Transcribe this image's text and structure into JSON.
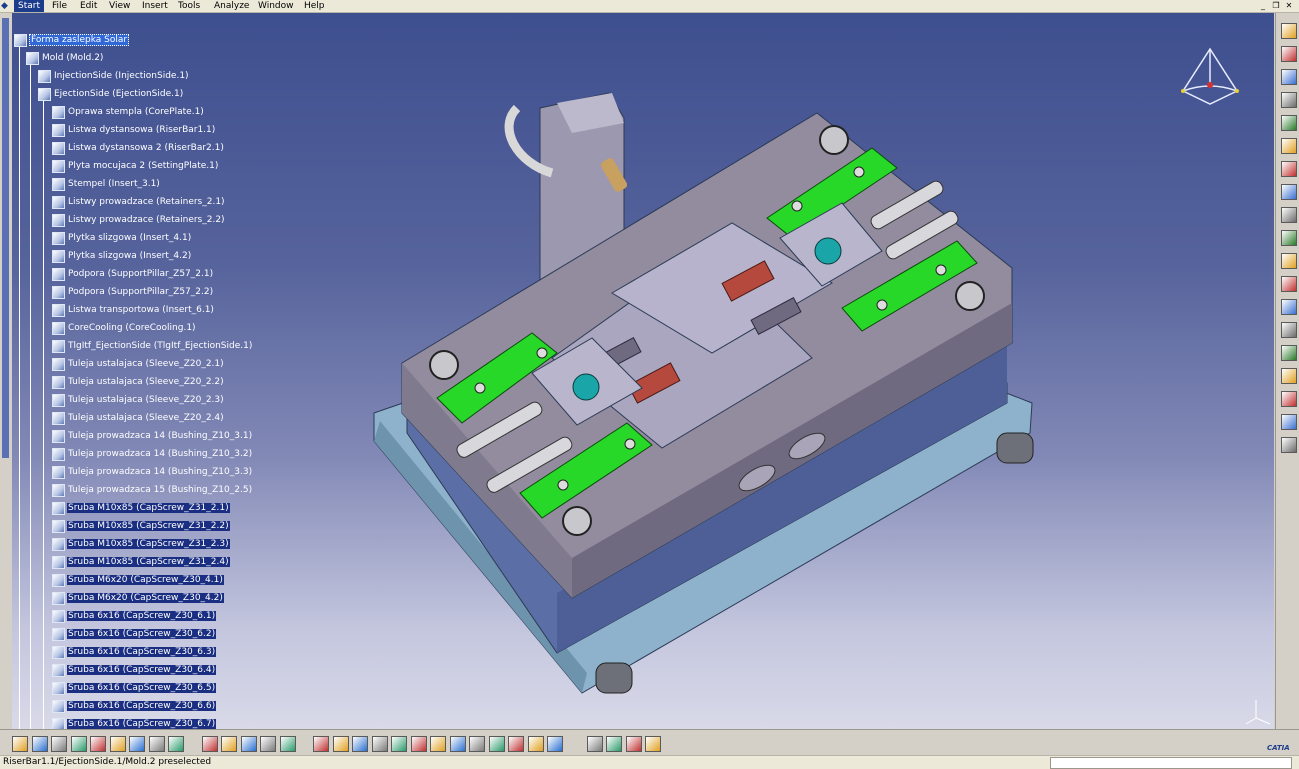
{
  "menu": {
    "start": "Start",
    "items": [
      "File",
      "Edit",
      "View",
      "Insert",
      "Tools",
      "Analyze",
      "Window",
      "Help"
    ]
  },
  "colors": {
    "background_top": "#3e4f8f",
    "background_bottom": "#d8d9e8",
    "retainer_green": "#28d828",
    "insert_red": "#b5493e",
    "plate_grey": "#9d97a8",
    "base_blue": "#8fb2cc",
    "tree_selection": "#1b2f82"
  },
  "tree": {
    "root": "Forma zaslepka Solar",
    "mold": "Mold (Mold.2)",
    "injection_side": "InjectionSide (InjectionSide.1)",
    "ejection_side": "EjectionSide (EjectionSide.1)",
    "children": [
      {
        "label": "Oprawa stempla (CorePlate.1)",
        "selected": false
      },
      {
        "label": "Listwa dystansowa (RiserBar1.1)",
        "selected": false
      },
      {
        "label": "Listwa dystansowa 2 (RiserBar2.1)",
        "selected": false
      },
      {
        "label": "Plyta mocujaca 2 (SettingPlate.1)",
        "selected": false
      },
      {
        "label": "Stempel (Insert_3.1)",
        "selected": false
      },
      {
        "label": "Listwy prowadzace (Retainers_2.1)",
        "selected": false
      },
      {
        "label": "Listwy prowadzace (Retainers_2.2)",
        "selected": false
      },
      {
        "label": "Plytka slizgowa (Insert_4.1)",
        "selected": false
      },
      {
        "label": "Plytka slizgowa (Insert_4.2)",
        "selected": false
      },
      {
        "label": "Podpora (SupportPillar_Z57_2.1)",
        "selected": false
      },
      {
        "label": "Podpora (SupportPillar_Z57_2.2)",
        "selected": false
      },
      {
        "label": "Listwa transportowa (Insert_6.1)",
        "selected": false
      },
      {
        "label": "CoreCooling (CoreCooling.1)",
        "selected": false
      },
      {
        "label": "TlgItf_EjectionSide (TlgItf_EjectionSide.1)",
        "selected": false
      },
      {
        "label": "Tuleja ustalajaca (Sleeve_Z20_2.1)",
        "selected": false
      },
      {
        "label": "Tuleja ustalajaca (Sleeve_Z20_2.2)",
        "selected": false
      },
      {
        "label": "Tuleja ustalajaca (Sleeve_Z20_2.3)",
        "selected": false
      },
      {
        "label": "Tuleja ustalajaca (Sleeve_Z20_2.4)",
        "selected": false
      },
      {
        "label": "Tuleja prowadzaca 14 (Bushing_Z10_3.1)",
        "selected": false
      },
      {
        "label": "Tuleja prowadzaca 14 (Bushing_Z10_3.2)",
        "selected": false
      },
      {
        "label": "Tuleja prowadzaca 14 (Bushing_Z10_3.3)",
        "selected": false
      },
      {
        "label": "Tuleja prowadzaca 15 (Bushing_Z10_2.5)",
        "selected": false
      },
      {
        "label": "Sruba M10x85 (CapScrew_Z31_2.1)",
        "selected": true
      },
      {
        "label": "Sruba M10x85 (CapScrew_Z31_2.2)",
        "selected": true
      },
      {
        "label": "Sruba M10x85 (CapScrew_Z31_2.3)",
        "selected": true
      },
      {
        "label": "Sruba M10x85 (CapScrew_Z31_2.4)",
        "selected": true
      },
      {
        "label": "Sruba M6x20 (CapScrew_Z30_4.1)",
        "selected": true
      },
      {
        "label": "Sruba M6x20 (CapScrew_Z30_4.2)",
        "selected": true
      },
      {
        "label": "Sruba 6x16 (CapScrew_Z30_6.1)",
        "selected": true
      },
      {
        "label": "Sruba 6x16 (CapScrew_Z30_6.2)",
        "selected": true
      },
      {
        "label": "Sruba 6x16 (CapScrew_Z30_6.3)",
        "selected": true
      },
      {
        "label": "Sruba 6x16 (CapScrew_Z30_6.4)",
        "selected": true
      },
      {
        "label": "Sruba 6x16 (CapScrew_Z30_6.5)",
        "selected": true
      },
      {
        "label": "Sruba 6x16 (CapScrew_Z30_6.6)",
        "selected": true
      },
      {
        "label": "Sruba 6x16 (CapScrew_Z30_6.7)",
        "selected": true
      }
    ]
  },
  "right_toolbar": {
    "icons": [
      "sketch-icon",
      "select-arrow-icon",
      "move-icon",
      "product-icon",
      "existing-component-icon",
      "replace-icon",
      "graph-tree-icon",
      "plate-icon",
      "pillar-icon",
      "screw-icon",
      "pin-icon",
      "bushing-icon",
      "sleeve-icon",
      "angle-pin-icon",
      "ejector-icon",
      "cooling-icon",
      "gate-icon",
      "runner-icon",
      "analysis-icon"
    ]
  },
  "bottom_toolbar": {
    "icons": [
      "new-icon",
      "open-icon",
      "save-icon",
      "cut-icon",
      "copy-icon",
      "paste-icon",
      "undo-icon",
      "redo-icon",
      "whats-this-icon",
      "formula-icon",
      "comment-icon",
      "measure-icon",
      "table-icon",
      "parameters-icon",
      "fly-mode-icon",
      "fit-all-icon",
      "pan-icon",
      "rotate-icon",
      "zoom-in-icon",
      "zoom-out-icon",
      "normal-view-icon",
      "multi-view-icon",
      "iso-view-icon",
      "shading-icon",
      "hide-show-icon",
      "swap-space-icon",
      "snapshot-icon",
      "compass-icon",
      "update-icon",
      "manipulate-icon",
      "explode-icon"
    ]
  },
  "status": {
    "text": "RiserBar1.1/EjectionSide.1/Mold.2 preselected"
  },
  "catia_logo": "CATIA"
}
